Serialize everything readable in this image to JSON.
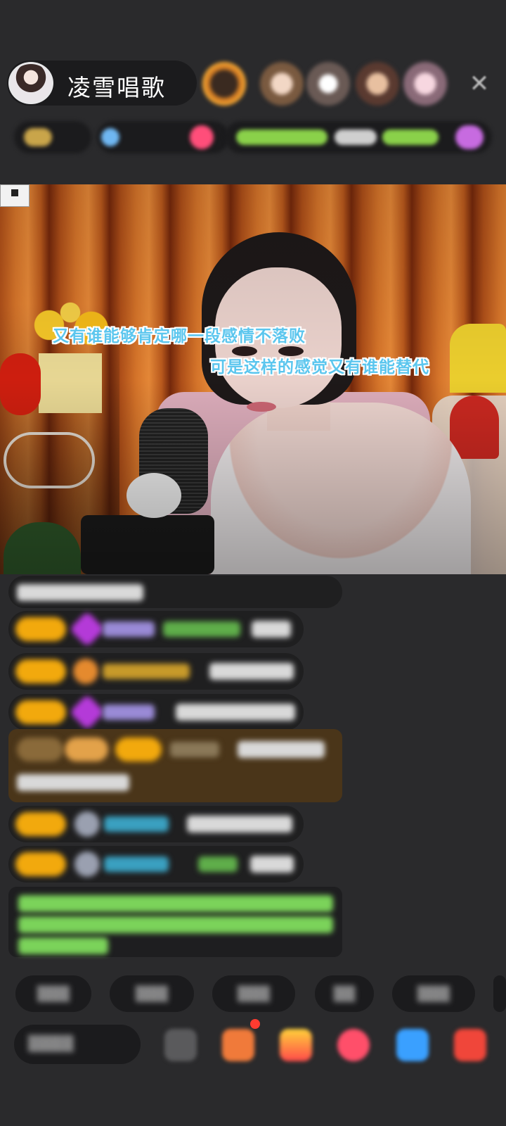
{
  "header": {
    "host_name": "凌雪唱歌",
    "close_icon": "close-icon"
  },
  "video": {
    "lyric_line_1": "又有谁能够肯定哪一段感情不落败",
    "lyric_line_2": "可是这样的感觉又有谁能替代"
  },
  "colors": {
    "background": "#2a2a2c",
    "level_badge": "#f2a90d",
    "lyric_text": "#5bc6ee",
    "gold_card": "#4a3519",
    "system_text": "#7bd35a"
  },
  "bottom_bar": {
    "icons": [
      "emoji-icon",
      "gift-box-icon",
      "gift-icon",
      "red-packet-icon",
      "share-icon",
      "more-icon"
    ]
  }
}
